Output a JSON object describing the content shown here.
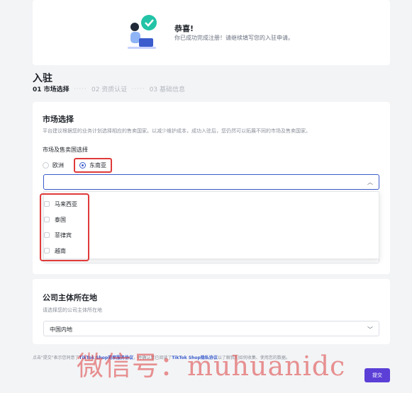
{
  "congrats": {
    "title": "恭喜!",
    "subtitle": "你已成功完成注册！请继续填写您的入驻申请。"
  },
  "page": {
    "title": "入驻",
    "steps": [
      {
        "label": "01 市场选择",
        "active": true
      },
      {
        "label": "02 资质认证",
        "active": false
      },
      {
        "label": "03 基础信息",
        "active": false
      }
    ],
    "step_separator": "·····"
  },
  "market": {
    "title": "市场选择",
    "description": "平台建议根据您的业务计划选择相应的售卖国家。以减少维护成本，成功入驻后，您仍然可以拓展不同的市场及售卖国家。",
    "label": "市场及售卖国选择",
    "regions": [
      {
        "label": "欧洲",
        "selected": false
      },
      {
        "label": "东南亚",
        "selected": true
      }
    ],
    "countries": [
      "马来西亚",
      "泰国",
      "菲律宾",
      "越南"
    ]
  },
  "company": {
    "title": "公司主体所在地",
    "description": "请选择您的公司主体所在地",
    "value": "中国内地"
  },
  "footer": {
    "prefix": "点击\"提交\"表示您同意了",
    "link1": "TikTok Shop商家服务协议",
    "middle": "，并确认您已阅读了",
    "link2": "TikTok Shop隐私协议",
    "suffix": "以了解我们如何收集、使用您的数据。",
    "submit": "提交"
  },
  "watermark": "微信号：muhuanidc",
  "colors": {
    "accent": "#3b5ccc",
    "highlight": "#e03a3a",
    "button": "#5b3fd6"
  }
}
